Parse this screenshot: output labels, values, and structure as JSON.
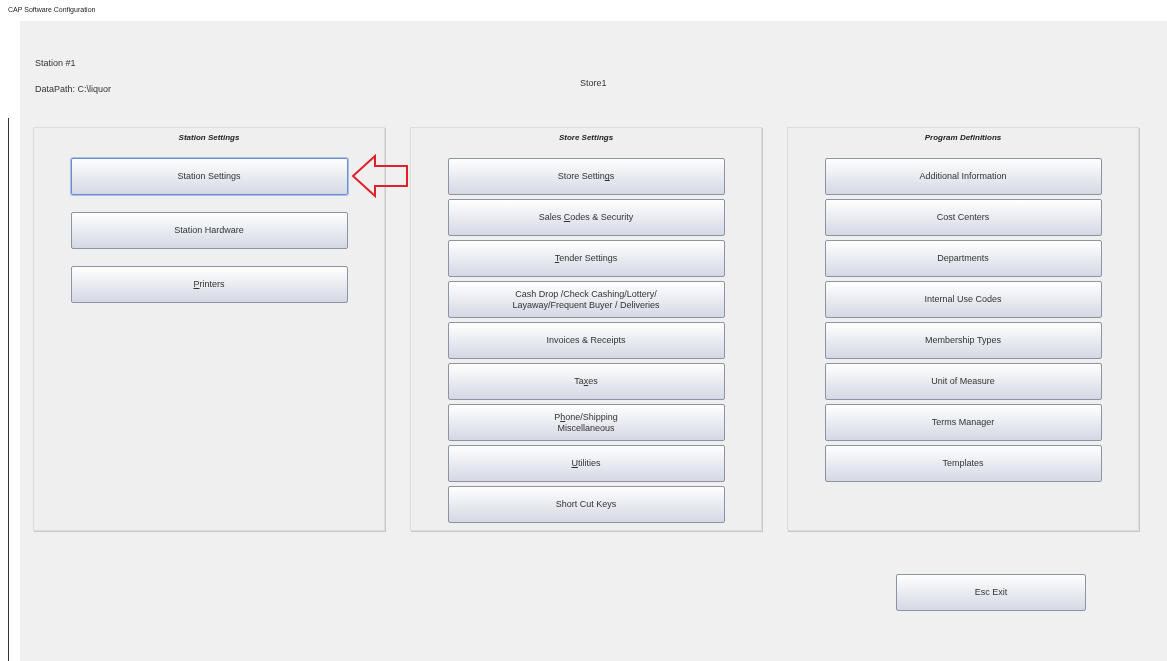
{
  "window": {
    "title": "CAP Software Configuration"
  },
  "station": "Station #1",
  "data_path": "DataPath: C:\\liquor",
  "store_name": "Store1",
  "panels": [
    {
      "title": "Station Settings",
      "wide_spacing": true,
      "buttons": [
        {
          "label": [
            {
              "text": "Station Settings",
              "underlined": false
            }
          ],
          "focused": true,
          "pointer_arrow": true
        },
        {
          "label": [
            {
              "text": "Station Hardware",
              "underlined": false
            }
          ],
          "focused": false
        },
        {
          "label": [
            {
              "text": "P",
              "underlined": true
            },
            {
              "text": "rinters",
              "underlined": false
            }
          ],
          "focused": false
        }
      ]
    },
    {
      "title": "Store Settings",
      "wide_spacing": false,
      "buttons": [
        {
          "label": [
            {
              "text": "Store Settin",
              "underlined": false
            },
            {
              "text": "g",
              "underlined": true
            },
            {
              "text": "s",
              "underlined": false
            }
          ],
          "focused": false
        },
        {
          "label": [
            {
              "text": "Sales ",
              "underlined": false
            },
            {
              "text": "C",
              "underlined": true
            },
            {
              "text": "odes & Security",
              "underlined": false
            }
          ],
          "focused": false
        },
        {
          "label": [
            {
              "text": "T",
              "underlined": true
            },
            {
              "text": "ender Settings",
              "underlined": false
            }
          ],
          "focused": false
        },
        {
          "label": [
            {
              "text": "Cash Drop /Check Cashing/Lottery/\nLayaway/Frequent Buyer / Deliveries",
              "underlined": false
            }
          ],
          "focused": false
        },
        {
          "label": [
            {
              "text": "Invoices & Receipts",
              "underlined": false
            }
          ],
          "focused": false
        },
        {
          "label": [
            {
              "text": "Ta",
              "underlined": false
            },
            {
              "text": "x",
              "underlined": true
            },
            {
              "text": "es",
              "underlined": false
            }
          ],
          "focused": false
        },
        {
          "label": [
            {
              "text": "P",
              "underlined": false
            },
            {
              "text": "h",
              "underlined": true
            },
            {
              "text": "one/Shipping\nMiscellaneous",
              "underlined": false
            }
          ],
          "focused": false
        },
        {
          "label": [
            {
              "text": "U",
              "underlined": true
            },
            {
              "text": "tilities",
              "underlined": false
            }
          ],
          "focused": false
        },
        {
          "label": [
            {
              "text": "Short Cut Keys",
              "underlined": false
            }
          ],
          "focused": false
        }
      ]
    },
    {
      "title": "Program Definitions",
      "wide_spacing": false,
      "buttons": [
        {
          "label": [
            {
              "text": "Additional Information",
              "underlined": false
            }
          ],
          "focused": false
        },
        {
          "label": [
            {
              "text": "Cost Centers",
              "underlined": false
            }
          ],
          "focused": false
        },
        {
          "label": [
            {
              "text": "Departments",
              "underlined": false
            }
          ],
          "focused": false
        },
        {
          "label": [
            {
              "text": "Internal Use Codes",
              "underlined": false
            }
          ],
          "focused": false
        },
        {
          "label": [
            {
              "text": "Membership Types",
              "underlined": false
            }
          ],
          "focused": false
        },
        {
          "label": [
            {
              "text": "Unit of Measure",
              "underlined": false
            }
          ],
          "focused": false
        },
        {
          "label": [
            {
              "text": "Terms Manager",
              "underlined": false
            }
          ],
          "focused": false
        },
        {
          "label": [
            {
              "text": "Templates",
              "underlined": false
            }
          ],
          "focused": false
        }
      ]
    }
  ],
  "exit_button": {
    "label": "Esc Exit"
  }
}
